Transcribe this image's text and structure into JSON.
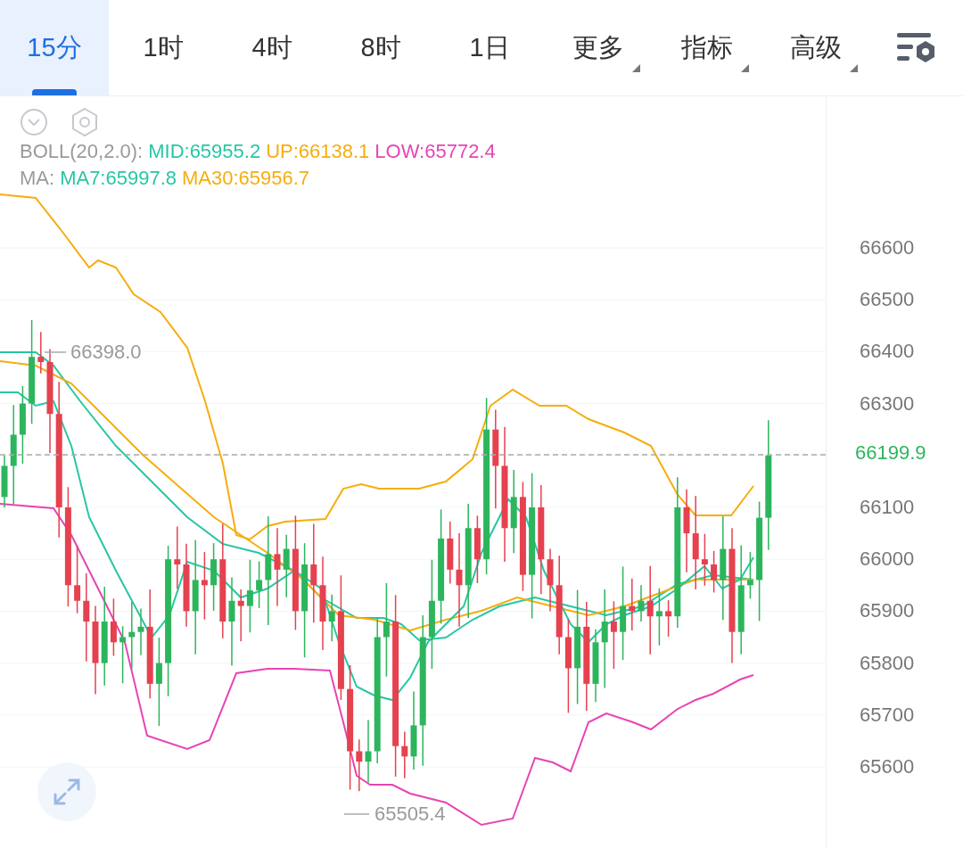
{
  "tabs": [
    {
      "label": "15分",
      "kind": "interval",
      "selected": true
    },
    {
      "label": "1时",
      "kind": "interval",
      "selected": false
    },
    {
      "label": "4时",
      "kind": "interval",
      "selected": false
    },
    {
      "label": "8时",
      "kind": "interval",
      "selected": false
    },
    {
      "label": "1日",
      "kind": "interval",
      "selected": false
    },
    {
      "label": "更多",
      "kind": "dropdown",
      "selected": false
    },
    {
      "label": "指标",
      "kind": "dropdown",
      "selected": false
    },
    {
      "label": "高级",
      "kind": "dropdown",
      "selected": false
    }
  ],
  "legend": [
    {
      "label": "BOLL(20,2.0):",
      "values": [
        {
          "text": "MID:65955.2",
          "color": "#27c6a4"
        },
        {
          "text": "UP:66138.1",
          "color": "#f6ad0c"
        },
        {
          "text": "LOW:65772.4",
          "color": "#e744b4"
        }
      ]
    },
    {
      "label": "MA:",
      "values": [
        {
          "text": "MA7:65997.8",
          "color": "#27c6a4"
        },
        {
          "text": "MA30:65956.7",
          "color": "#f6ad0c"
        }
      ]
    }
  ],
  "chart": {
    "price_axis_upper": [
      "66600",
      "66500",
      "66400",
      "66300"
    ],
    "price_axis_lower": [
      "66100",
      "66000",
      "65900",
      "65800",
      "65700",
      "65600"
    ],
    "high_marker": "66398.0",
    "low_marker": "65505.4",
    "last_price": "66199.9"
  }
}
